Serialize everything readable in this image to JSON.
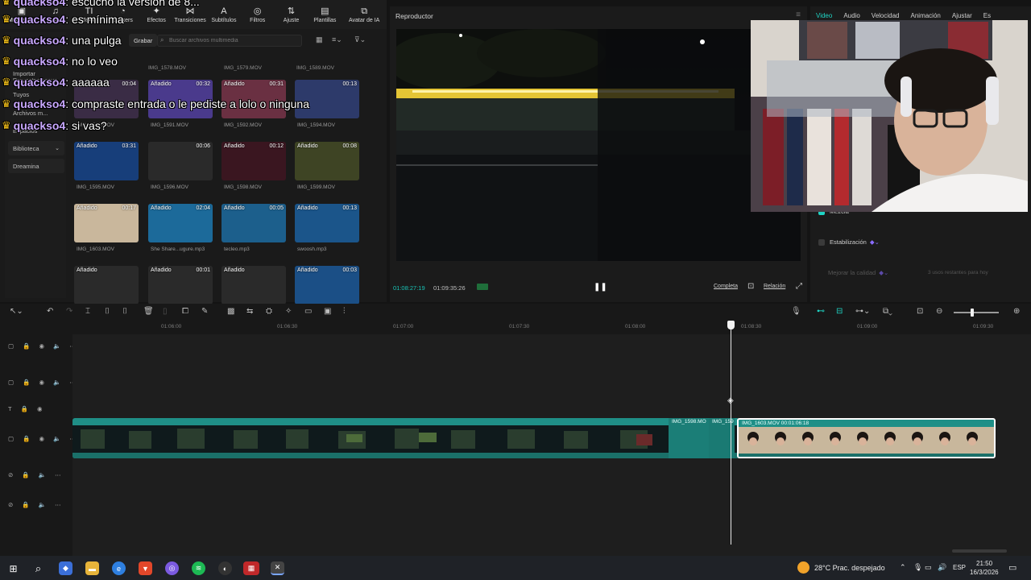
{
  "toolbar": {
    "items": [
      {
        "label": "Multimedia",
        "icon": "media-icon"
      },
      {
        "label": "Audio",
        "icon": "audio-icon"
      },
      {
        "label": "Texto",
        "icon": "text-icon"
      },
      {
        "label": "Stickers",
        "icon": "sticker-icon"
      },
      {
        "label": "Efectos",
        "icon": "effects-icon"
      },
      {
        "label": "Transiciones",
        "icon": "transitions-icon"
      },
      {
        "label": "Subtítulos",
        "icon": "subtitles-icon"
      },
      {
        "label": "Filtros",
        "icon": "filters-icon"
      },
      {
        "label": "Ajuste",
        "icon": "adjust-icon"
      },
      {
        "label": "Plantillas",
        "icon": "templates-icon"
      },
      {
        "label": "Avatar de IA",
        "icon": "ai-avatar-icon"
      }
    ]
  },
  "sidenav": {
    "local": "Local",
    "import": "Importar",
    "projects": "Proyectos secun...",
    "yours": "Tuyos",
    "files": "Archivos m...",
    "spaces": "Espacios",
    "library": "Biblioteca",
    "dreamina": "Dreamina"
  },
  "search": {
    "record_label": "Grabar",
    "placeholder": "Buscar archivos multimedia"
  },
  "media": {
    "header_names": [
      "IMG_1578.MOV",
      "IMG_1579.MOV",
      "IMG_1589.MOV"
    ],
    "first_row_name": "IMG_1590.MOV",
    "items": [
      {
        "tag": "",
        "duration": "00:04",
        "name": "IMG_1590.MOV",
        "color": "#3a2c45"
      },
      {
        "tag": "Añadido",
        "duration": "00:32",
        "name": "IMG_1591.MOV",
        "color": "#4a3a8c"
      },
      {
        "tag": "Añadido",
        "duration": "00:31",
        "name": "IMG_1592.MOV",
        "color": "#6a3042"
      },
      {
        "tag": "",
        "duration": "00:13",
        "name": "IMG_1594.MOV",
        "color": "#2d3a6a"
      },
      {
        "tag": "Añadido",
        "duration": "03:31",
        "name": "IMG_1595.MOV",
        "color": "#173e7a"
      },
      {
        "tag": "",
        "duration": "00:06",
        "name": "IMG_1596.MOV",
        "color": "#2a2a2a"
      },
      {
        "tag": "Añadido",
        "duration": "00:12",
        "name": "IMG_1598.MOV",
        "color": "#3a1620"
      },
      {
        "tag": "Añadido",
        "duration": "00:08",
        "name": "IMG_1599.MOV",
        "color": "#3e4424"
      },
      {
        "tag": "Añadido",
        "duration": "00:17",
        "name": "IMG_1603.MOV",
        "color": "#c9b79c"
      },
      {
        "tag": "Añadido",
        "duration": "02:04",
        "name": "She Share...ugure.mp3",
        "color": "#1c6a9a"
      },
      {
        "tag": "Añadido",
        "duration": "00:05",
        "name": "tecleo.mp3",
        "color": "#1c5f8c"
      },
      {
        "tag": "Añadido",
        "duration": "00:13",
        "name": "swoosh.mp3",
        "color": "#1b558a"
      },
      {
        "tag": "Añadido",
        "duration": "",
        "name": "",
        "color": "#2a2a2a"
      },
      {
        "tag": "Añadido",
        "duration": "00:01",
        "name": "",
        "color": "#2a2a2a"
      },
      {
        "tag": "Añadido",
        "duration": "",
        "name": "",
        "color": "#2a2a2a"
      },
      {
        "tag": "Añadido",
        "duration": "00:03",
        "name": "",
        "color": "#1b4f86"
      }
    ]
  },
  "chat": [
    {
      "user": "quackso4",
      "msg": ": escucho la versión de 8..."
    },
    {
      "user": "quackso4",
      "msg": ": es mínima"
    },
    {
      "user": "quackso4",
      "msg": ": una pulga"
    },
    {
      "user": "quackso4",
      "msg": ": no lo veo"
    },
    {
      "user": "quackso4",
      "msg": ": aaaaaa"
    },
    {
      "user": "quackso4",
      "msg": ": compraste entrada o le pediste a lolo o ninguna"
    },
    {
      "user": "quackso4",
      "msg": ": si vas?"
    }
  ],
  "player": {
    "title": "Reproductor",
    "current": "01:08:27:19",
    "total": "01:09:35:26",
    "full_label": "Completa",
    "ratio_label": "Relación"
  },
  "props": {
    "tabs": [
      "Video",
      "Audio",
      "Velocidad",
      "Animación",
      "Ajustar",
      "Es"
    ],
    "mix": "Mezcla",
    "stabilize": "Estabilización",
    "enhance": "Mejorar la calidad",
    "enhance_note": "3 usos restantes para hoy"
  },
  "timeline": {
    "ticks": [
      "01:06:00",
      "01:06:30",
      "01:07:00",
      "01:07:30",
      "01:08:00",
      "01:08:30",
      "01:09:00",
      "01:09:30"
    ],
    "clip_a_label": "IMG_1598.MO",
    "clip_b_label": "IMG_159",
    "clip_sel_label": "IMG_1603.MOV  00:01:06:18"
  },
  "taskbar": {
    "weather": "28°C  Prac. despejado",
    "lang": "ESP",
    "time": "21:50",
    "date": "16/3/2026"
  },
  "colors": {
    "accent": "#1fd4c4",
    "clip": "#1f8f87",
    "chat_user": "#c9a8ff",
    "crown": "#f6c21a"
  }
}
